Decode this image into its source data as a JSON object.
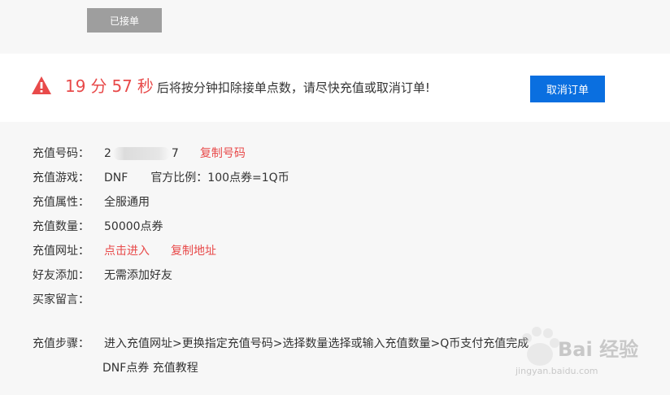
{
  "top": {
    "accepted_label": "已接单"
  },
  "warning": {
    "minutes": "19",
    "min_unit": "分",
    "seconds": "57",
    "sec_unit": "秒",
    "message": "后将按分钟扣除接单点数，请尽快充值或取消订单!",
    "cancel_label": "取消订单",
    "icon": "warning-triangle-icon"
  },
  "info": {
    "number_label": "充值号码：",
    "number_prefix": "2",
    "number_suffix": "7",
    "copy_number": "复制号码",
    "game_label": "充值游戏：",
    "game_value": "DNF",
    "ratio_text": "官方比例：100点券=1Q币",
    "attr_label": "充值属性：",
    "attr_value": "全服通用",
    "qty_label": "充值数量：",
    "qty_value": "50000点券",
    "url_label": "充值网址：",
    "url_enter": "点击进入",
    "url_copy": "复制地址",
    "friend_label": "好友添加：",
    "friend_value": "无需添加好友",
    "msg_label": "买家留言：",
    "steps_label": "充值步骤：",
    "steps_value": "进入充值网址>更换指定充值号码>选择数量选择或输入充值数量>Q币支付充值完成",
    "steps_sub": "DNF点券 充值教程"
  },
  "watermark": {
    "text": "Bai 经验",
    "url": "jingyan.baidu.com"
  },
  "colors": {
    "accent_red": "#e84a4a",
    "primary_blue": "#0a6fe0",
    "disabled_gray": "#9e9e9e"
  }
}
